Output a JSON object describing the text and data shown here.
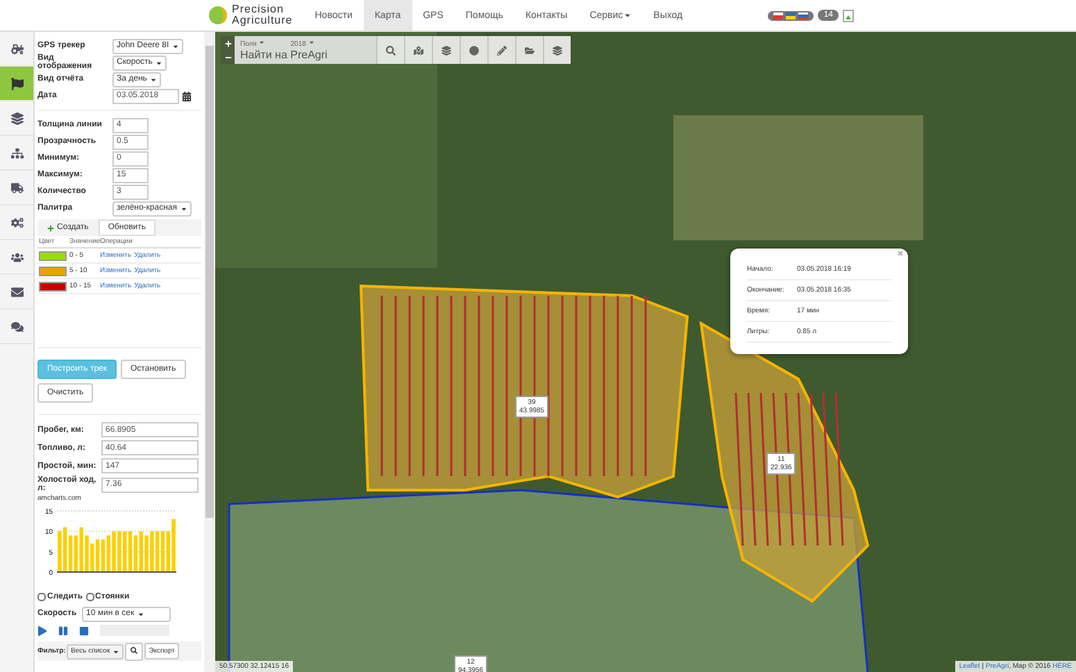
{
  "header": {
    "logo": {
      "line1": "Precision",
      "line2": "Agriculture"
    },
    "nav": [
      {
        "label": "Новости",
        "selected": false,
        "dropdown": false
      },
      {
        "label": "Карта",
        "selected": true,
        "dropdown": false
      },
      {
        "label": "GPS",
        "selected": false,
        "dropdown": false
      },
      {
        "label": "Помощь",
        "selected": false,
        "dropdown": false
      },
      {
        "label": "Контакты",
        "selected": false,
        "dropdown": false
      },
      {
        "label": "Сервис",
        "selected": false,
        "dropdown": true
      },
      {
        "label": "Выход",
        "selected": false,
        "dropdown": false
      }
    ],
    "badge": "14"
  },
  "rail": [
    {
      "selected": false
    },
    {
      "selected": true
    },
    {
      "selected": false
    },
    {
      "selected": false
    },
    {
      "selected": false
    },
    {
      "selected": false
    },
    {
      "selected": false
    },
    {
      "selected": false
    },
    {
      "selected": false
    }
  ],
  "panel": {
    "selects": [
      {
        "label": "GPS трекер",
        "value": "John Deere 8І"
      },
      {
        "label": "Вид отображения",
        "value": "Скорость"
      },
      {
        "label": "Вид отчёта",
        "value": "За день"
      }
    ],
    "date": {
      "label": "Дата",
      "value": "03.05.2018"
    },
    "params": [
      {
        "label": "Толщина линии",
        "value": "4"
      },
      {
        "label": "Прозрачность",
        "value": "0.5"
      },
      {
        "label": "Минимум:",
        "value": "0"
      },
      {
        "label": "Максимум:",
        "value": "15"
      },
      {
        "label": "Количество",
        "value": "3"
      }
    ],
    "palette": {
      "label": "Палитра",
      "value": "зелёно-красная"
    },
    "legend_tabs": [
      {
        "label": "Создать",
        "selected": false
      },
      {
        "label": "Обновить",
        "selected": true
      }
    ],
    "legend_columns": [
      "Цвет",
      "Значение",
      "Операции"
    ],
    "legend_rows": [
      {
        "color": "#99dd00",
        "range": "0 - 5",
        "edit": "Изменить",
        "delete": "Удалить"
      },
      {
        "color": "#f0a000",
        "range": "5 - 10",
        "edit": "Изменить",
        "delete": "Удалить"
      },
      {
        "color": "#cc0000",
        "range": "10 - 15",
        "edit": "Изменить",
        "delete": "Удалить"
      }
    ],
    "buttons": [
      {
        "label": "Построить трек",
        "primary": true
      },
      {
        "label": "Остановить",
        "primary": false
      },
      {
        "label": "Очистить",
        "primary": false
      }
    ],
    "stats": [
      {
        "label": "Пробег, км:",
        "value": "66.8905"
      },
      {
        "label": "Топливо, л:",
        "value": "40.64"
      },
      {
        "label": "Простой, мин:",
        "value": "147"
      },
      {
        "label": "Холостой ход, л:",
        "value": "7.36"
      }
    ],
    "chart_credit": "amcharts.com",
    "chart_data": {
      "type": "bar",
      "yticks": [
        0,
        5,
        10,
        15
      ],
      "ylim": [
        0,
        15
      ],
      "values": [
        10,
        11,
        9,
        9,
        11,
        9,
        7,
        8,
        8,
        9,
        10,
        10,
        10,
        10,
        9,
        10,
        9,
        10,
        10,
        10,
        10,
        13
      ]
    },
    "checks": [
      {
        "label": "Следить",
        "checked": false
      },
      {
        "label": "Стоянки",
        "checked": false
      }
    ],
    "speed": {
      "label": "Скорость",
      "value": "10 мин в сек"
    },
    "filter": {
      "label": "Фильтр:",
      "value": "Весь список",
      "export": "Экспорт"
    }
  },
  "map": {
    "search": {
      "filter": "Поля",
      "year": "2018",
      "placeholder": "Найти на PreAgri"
    },
    "field_labels": [
      {
        "number": "39",
        "area": "43.9985"
      },
      {
        "number": "11",
        "area": "22.936"
      },
      {
        "number": "12",
        "area": "94.3956"
      }
    ],
    "popup": {
      "rows": [
        {
          "label": "Начало:",
          "value": "03.05.2018 16:19"
        },
        {
          "label": "Окончание:",
          "value": "03.05.2018 16:35"
        },
        {
          "label": "Время:",
          "value": "17 мин"
        },
        {
          "label": "Литры:",
          "value": "0.85 л"
        }
      ]
    },
    "coordinates": "50.57300 32.12415 16",
    "attribution": {
      "links": [
        "Leaflet",
        "PreAgri"
      ],
      "separator": "|",
      "text": ", Map © 2016 ",
      "here": "HERE"
    }
  }
}
